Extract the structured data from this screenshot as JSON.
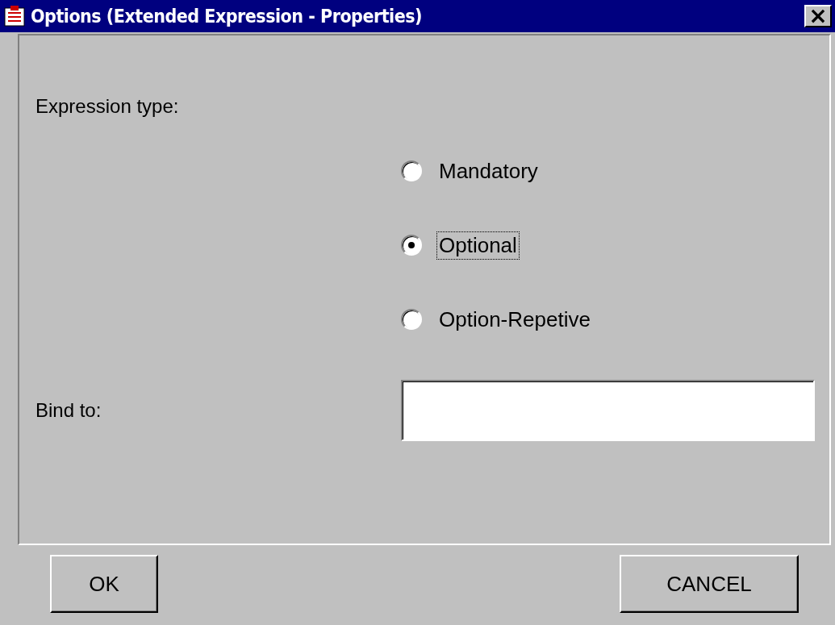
{
  "window": {
    "title": "Options (Extended Expression - Properties)",
    "close": "×"
  },
  "expression_type": {
    "label": "Expression type:",
    "options": [
      {
        "label": "Mandatory",
        "selected": false,
        "focused": false
      },
      {
        "label": "Optional",
        "selected": true,
        "focused": true
      },
      {
        "label": "Option-Repetive",
        "selected": false,
        "focused": false
      }
    ]
  },
  "bind_to": {
    "label": "Bind to:"
  },
  "buttons": [
    "OK",
    "CANCEL"
  ]
}
